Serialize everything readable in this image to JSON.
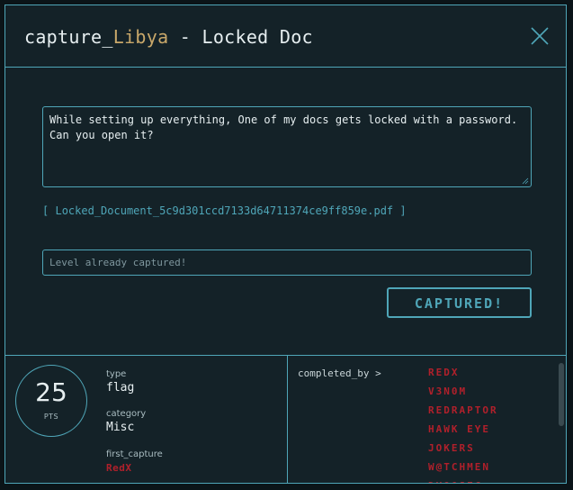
{
  "modal": {
    "title_prefix": "capture_",
    "title_name": "Libya",
    "title_suffix": " - Locked Doc",
    "close_icon": "close-icon"
  },
  "challenge": {
    "description_line1": "While setting up everything, One of my docs gets locked with a password.",
    "description_line2": "Can you open it?",
    "file_open": "[",
    "file_name": "Locked_Document_5c9d301ccd7133d64711374ce9ff859e.pdf",
    "file_close": "]"
  },
  "flag_form": {
    "placeholder": "Level already captured!",
    "submit_label": "CAPTURED!"
  },
  "stats": {
    "points": "25",
    "points_unit": "PTS",
    "type_label": "type",
    "type_value": "flag",
    "category_label": "category",
    "category_value": "Misc",
    "first_capture_label": "first_capture",
    "first_capture_value": "RedX",
    "completed_by_label": "completed_by >"
  },
  "completed_by": [
    "REDX",
    "V3N0M",
    "REDRAPTOR",
    "HAWK EYE",
    "JOKERS",
    "W@TCHMEN",
    "DXOOSEC"
  ],
  "colors": {
    "accent": "#4fa6b8",
    "background": "#142228",
    "highlight": "#c9a86a",
    "team_red": "#b0202b"
  }
}
